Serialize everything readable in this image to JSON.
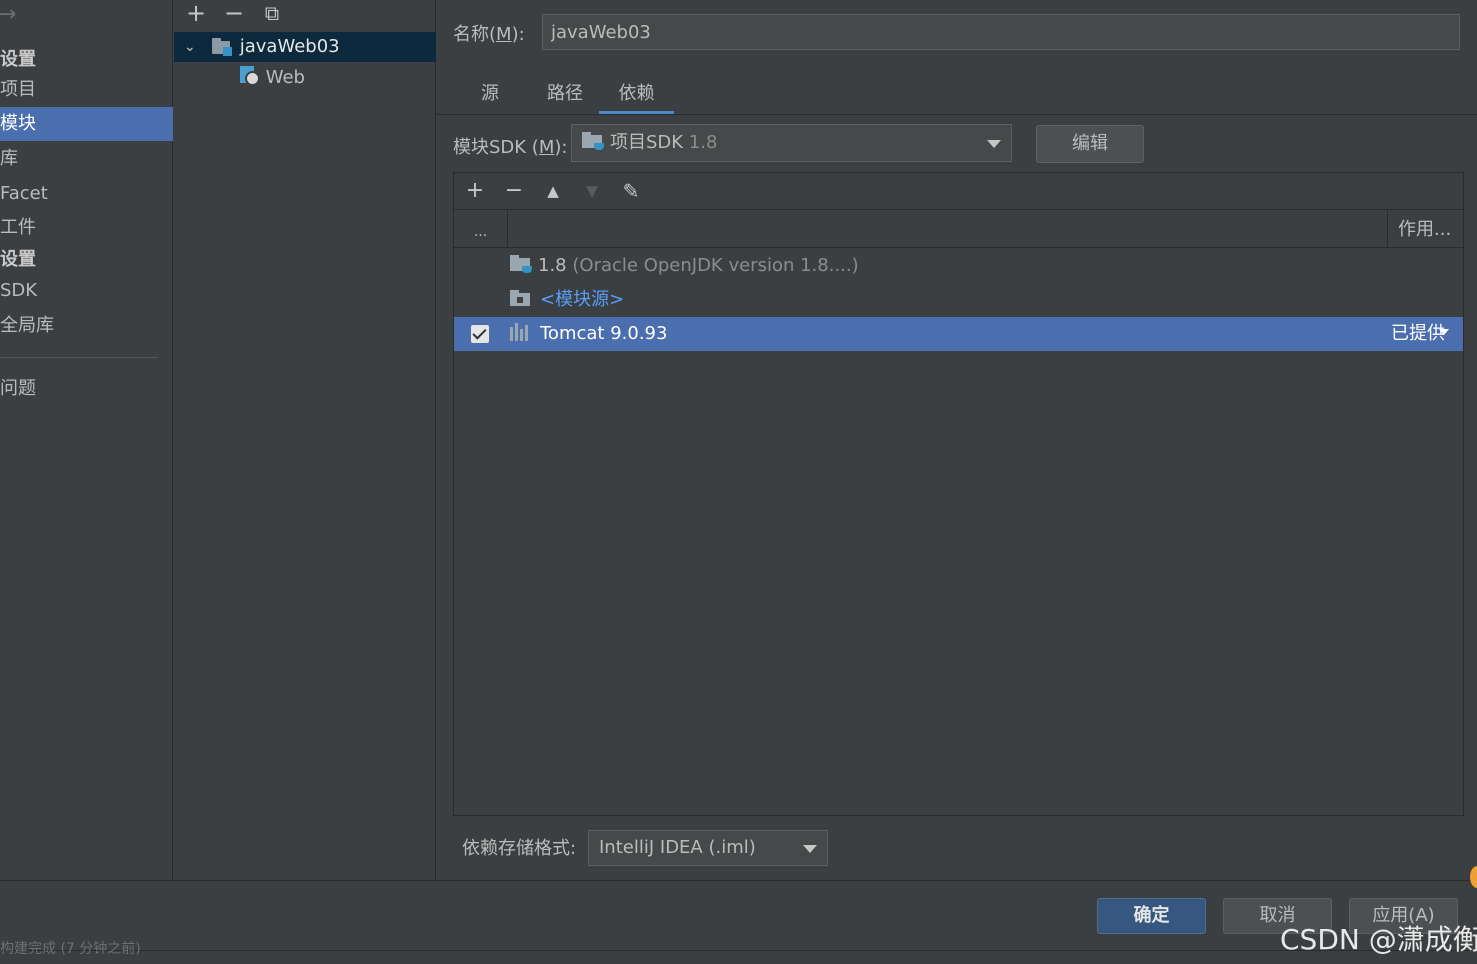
{
  "nav": {
    "items": [
      {
        "label": "设置",
        "bold": true
      },
      {
        "label": "项目"
      },
      {
        "label": "模块",
        "selected": true
      },
      {
        "label": "库"
      },
      {
        "label": "Facet"
      },
      {
        "label": "工件"
      },
      {
        "label": "设置",
        "bold": true
      },
      {
        "label": "SDK"
      },
      {
        "label": "全局库"
      },
      {
        "label": "问题"
      }
    ]
  },
  "tree": {
    "toolbar": {
      "add": "+",
      "remove": "−",
      "copy": "⧉"
    },
    "module": "javaWeb03",
    "facet": "Web"
  },
  "main": {
    "name_label": "名称(M):",
    "name_label_pre": "名称(",
    "name_label_mn": "M",
    "name_label_post": "):",
    "name_value": "javaWeb03",
    "tabs": [
      "源",
      "路径",
      "依赖"
    ],
    "active_tab": "依赖",
    "sdk_label_pre": "模块SDK (",
    "sdk_label_mn": "M",
    "sdk_label_post": "):",
    "sdk_value": "项目SDK",
    "sdk_version": "1.8",
    "edit_button": "编辑",
    "deps_header": {
      "col1": "...",
      "col3": "作用..."
    },
    "deps": [
      {
        "name": "1.8",
        "detail": "(Oracle OpenJDK version 1.8....)"
      },
      {
        "name": "<模块源>"
      },
      {
        "name": "Tomcat 9.0.93",
        "scope": "已提供",
        "checked": true,
        "selected": true
      }
    ],
    "storage_label": "依赖存储格式:",
    "storage_value": "IntelliJ IDEA (.iml)"
  },
  "footer": {
    "ok": "确定",
    "cancel": "取消",
    "apply": "应用(A)"
  },
  "status": "构建完成 (7 分钟之前)",
  "watermark": "CSDN @潇成衡",
  "colors": {
    "background": "#3c3f41",
    "selection": "#4b6eaf",
    "tree_selection": "#0d293e",
    "accent": "#4a88c7",
    "link": "#589df6"
  }
}
